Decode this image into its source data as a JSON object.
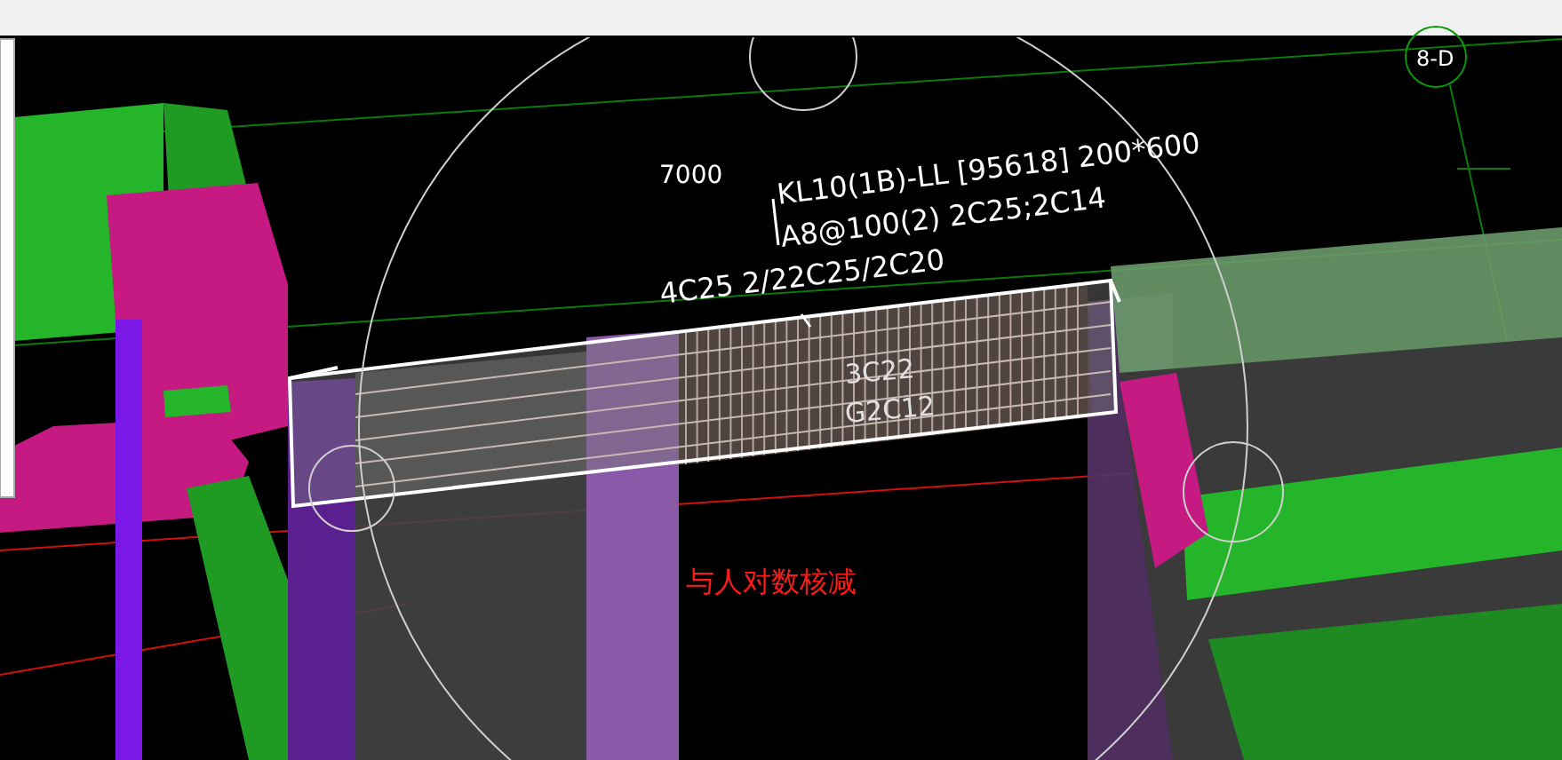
{
  "viewport": {
    "axis_label": "8-D",
    "dimension": "7000",
    "beam_label": [
      "KL10(1B)-LL [95618] 200*600",
      "A8@100(2) 2C25;2C14",
      "4C25 2/22C25/2C20"
    ],
    "beam_inner_labels": [
      "3C22",
      "G2C12"
    ],
    "annotation": "与人对数核减"
  }
}
